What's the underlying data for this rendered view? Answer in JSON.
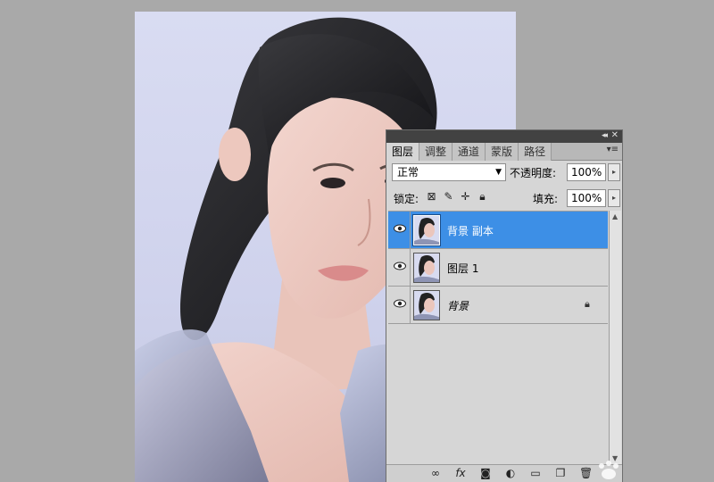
{
  "panel": {
    "tabs": [
      {
        "label": "图层",
        "active": true
      },
      {
        "label": "调整",
        "active": false
      },
      {
        "label": "通道",
        "active": false
      },
      {
        "label": "蒙版",
        "active": false
      },
      {
        "label": "路径",
        "active": false
      }
    ],
    "blend_mode": "正常",
    "opacity_label": "不透明度:",
    "opacity_value": "100%",
    "lock_label": "锁定:",
    "lock_icons": [
      "lock-transparent-icon",
      "lock-image-icon",
      "lock-position-icon",
      "lock-all-icon"
    ],
    "fill_label": "填充:",
    "fill_value": "100%",
    "layers": [
      {
        "name": "背景 副本",
        "selected": true,
        "locked": false
      },
      {
        "name": "图层 1",
        "selected": false,
        "locked": false
      },
      {
        "name": "背景",
        "selected": false,
        "locked": true
      }
    ],
    "bottom_icons": [
      "link-layers-icon",
      "fx-icon",
      "add-mask-icon",
      "adjustment-layer-icon",
      "new-group-icon",
      "new-layer-icon",
      "delete-layer-icon"
    ]
  },
  "colors": {
    "selection": "#3d8fe6",
    "panel_bg": "#d6d6d6",
    "workspace_bg": "#a9a9a9"
  }
}
